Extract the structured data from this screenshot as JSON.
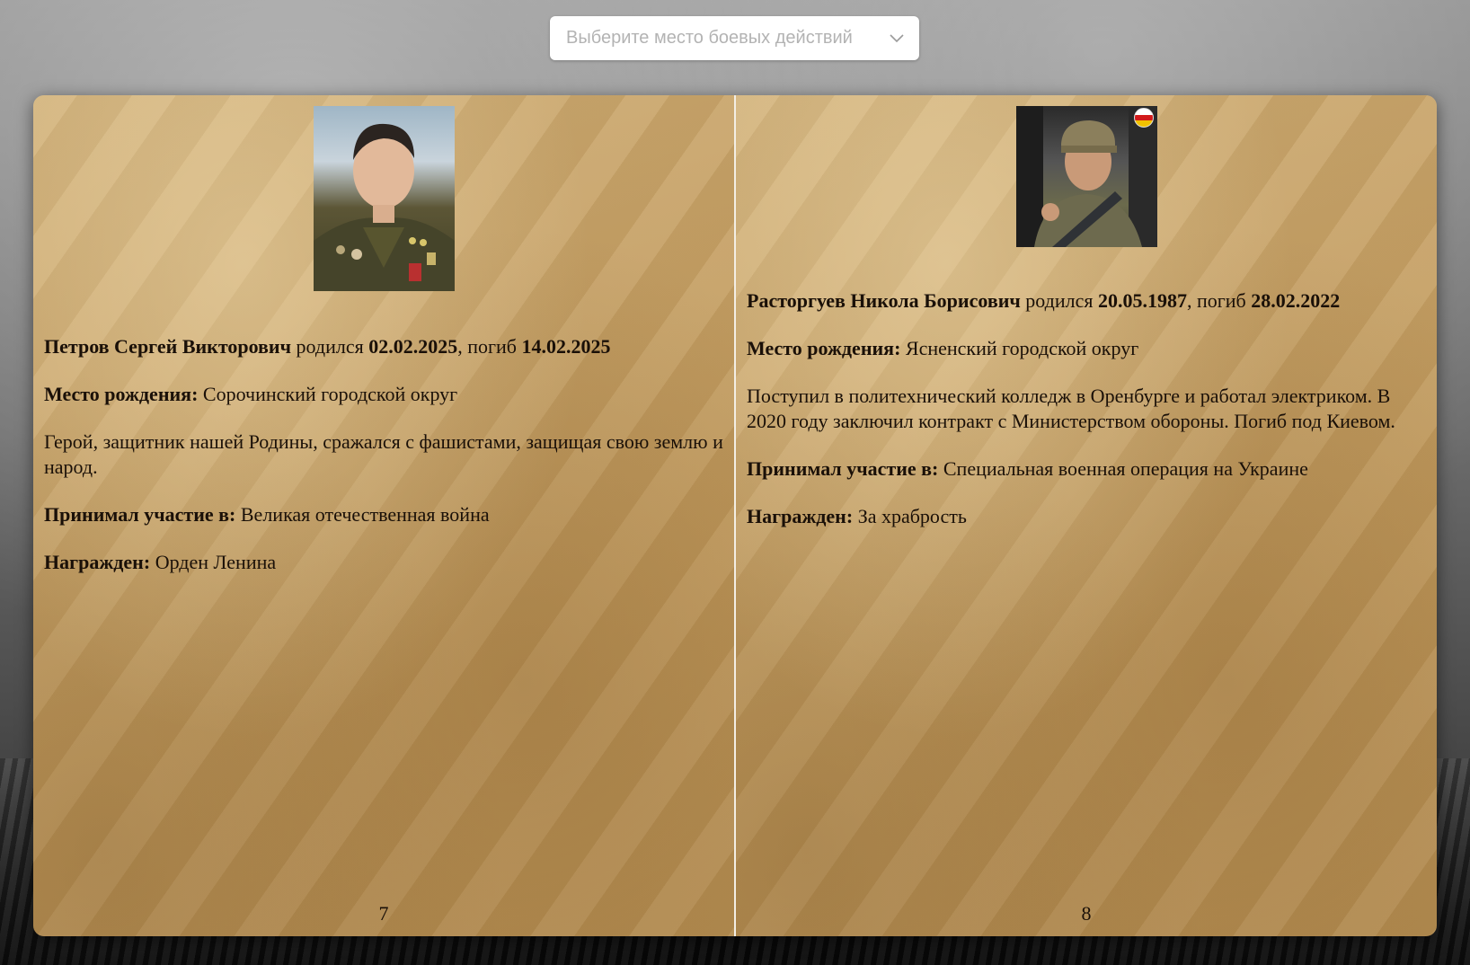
{
  "filter": {
    "placeholder": "Выберите место боевых действий",
    "icon": "chevron-down-icon"
  },
  "pages": [
    {
      "name": "Петров Сергей Викторович",
      "born_word": "родился",
      "birth_date": "02.02.2025",
      "died_word": ", погиб",
      "death_date": "14.02.2025",
      "birthplace_label": "Место рождения:",
      "birthplace": "Сорочинский городской округ",
      "bio": "Герой, защитник нашей Родины, сражался с фашистами, защищая свою землю и народ.",
      "participation_label": "Принимал участие в:",
      "participation": "Великая отечественная война",
      "award_label": "Награжден:",
      "award": "Орден Ленина",
      "page_number": "7"
    },
    {
      "name": "Расторгуев Никола Борисович",
      "born_word": "родился",
      "birth_date": "20.05.1987",
      "died_word": ", погиб",
      "death_date": "28.02.2022",
      "birthplace_label": "Место рождения:",
      "birthplace": "Ясненский городской округ",
      "bio": "Поступил в политехнический колледж в Оренбурге и работал электриком. В 2020 году заключил контракт с Министерством обороны. Погиб под Киевом.",
      "participation_label": "Принимал участие в:",
      "participation": "Специальная военная операция на Украине",
      "award_label": "Награжден:",
      "award": "За храбрость",
      "page_number": "8"
    }
  ]
}
